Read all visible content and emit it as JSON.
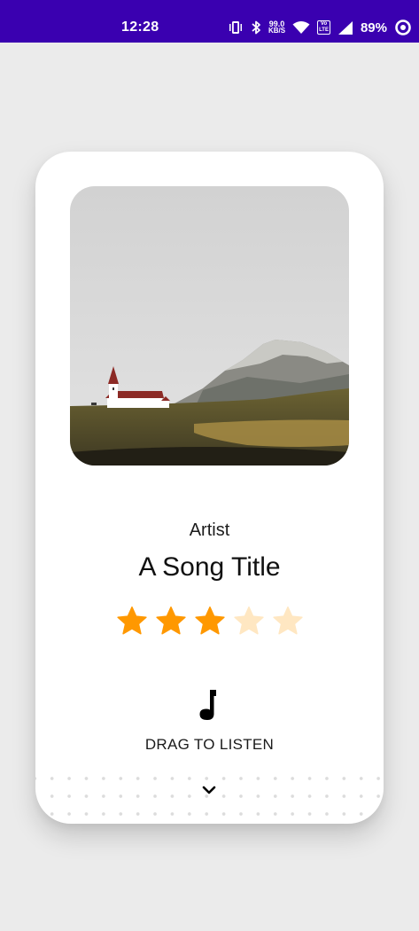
{
  "status_bar": {
    "time": "12:28",
    "net_speed_value": "99.0",
    "net_speed_unit": "KB/S",
    "volte_label": "Vo\nLTE",
    "battery_percent": "89%",
    "icons": [
      "vibrate-icon",
      "bluetooth-icon",
      "wifi-icon",
      "volte-icon",
      "signal-icon",
      "battery-saver-icon"
    ],
    "background_color": "#3a00b0"
  },
  "player": {
    "artist": "Artist",
    "song_title": "A Song Title",
    "rating": {
      "value": 3,
      "max": 5
    },
    "colors": {
      "star_filled": "#ff9800",
      "star_empty": "#ffe7c2"
    },
    "drag_label": "DRAG TO LISTEN",
    "music_icon": "music-note-icon",
    "expand_icon": "chevron-down-icon"
  }
}
